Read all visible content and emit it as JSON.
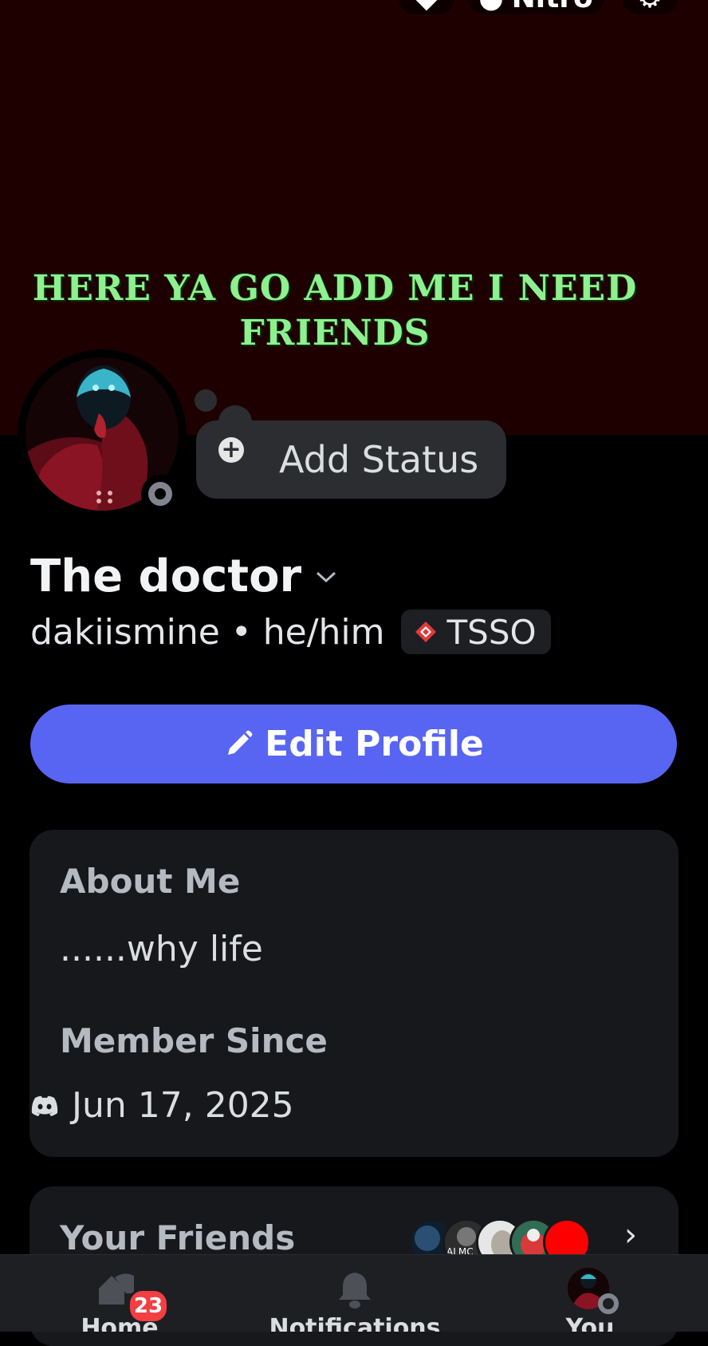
{
  "header": {
    "nitro_label": "Nitro"
  },
  "overlay": {
    "caption": "HERE YA GO ADD ME I NEED FRIENDS"
  },
  "status": {
    "add_status_label": "Add Status"
  },
  "profile": {
    "display_name": "The doctor",
    "username": "dakiismine",
    "separator": "•",
    "pronouns": "he/him",
    "server_tag": "TSSO"
  },
  "actions": {
    "edit_profile_label": "Edit Profile"
  },
  "about": {
    "heading": "About Me",
    "text": "......why life"
  },
  "member_since": {
    "heading": "Member Since",
    "date": "Jun 17, 2025"
  },
  "friends": {
    "heading": "Your Friends",
    "avatar_label": "ALMC"
  },
  "nav": {
    "home_label": "Home",
    "home_badge": "23",
    "notifications_label": "Notifications",
    "you_label": "You"
  },
  "colors": {
    "banner": "#1f0000",
    "accent": "#5865f2",
    "caption": "#8ef08e",
    "badge": "#f23f43"
  }
}
